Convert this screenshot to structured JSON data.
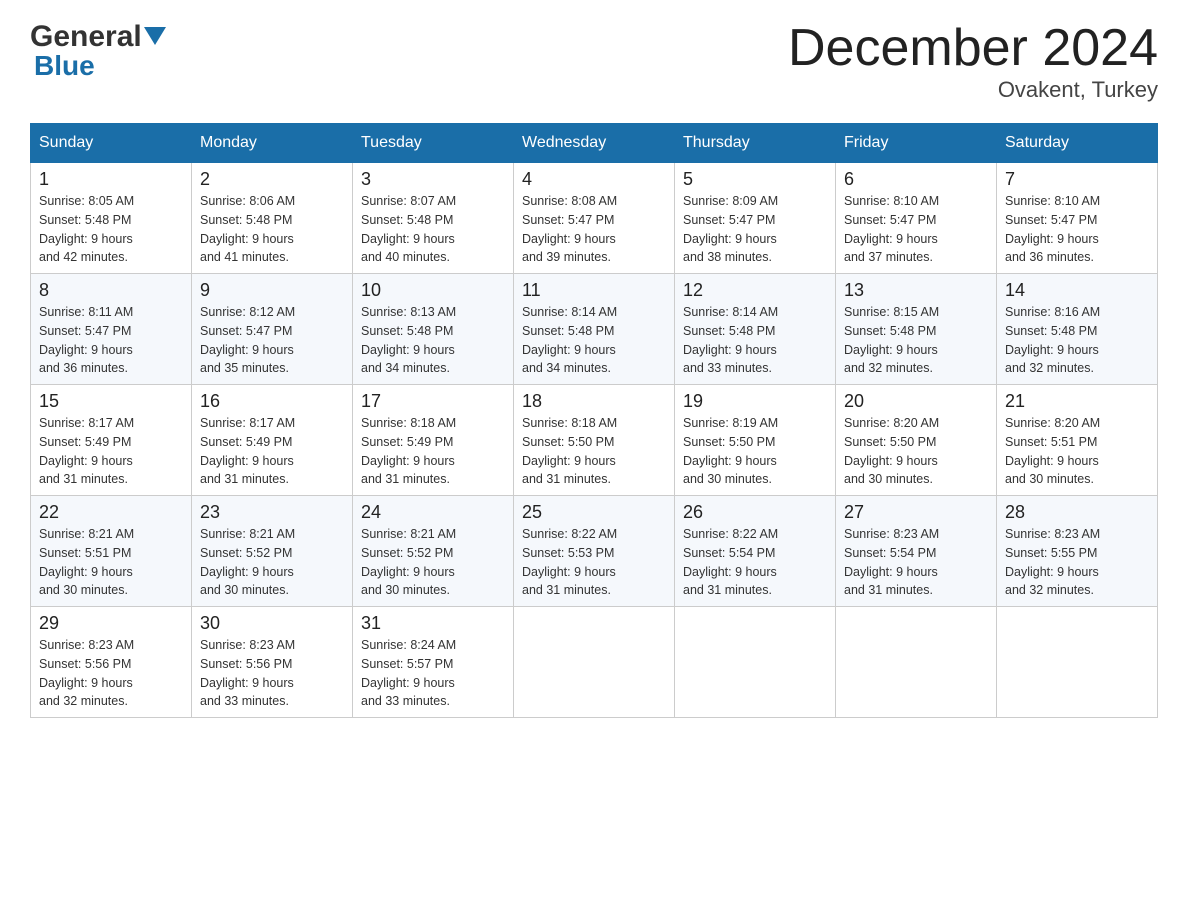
{
  "header": {
    "logo_general": "General",
    "logo_blue": "Blue",
    "title": "December 2024",
    "subtitle": "Ovakent, Turkey"
  },
  "days_of_week": [
    "Sunday",
    "Monday",
    "Tuesday",
    "Wednesday",
    "Thursday",
    "Friday",
    "Saturday"
  ],
  "weeks": [
    [
      {
        "num": "1",
        "sunrise": "8:05 AM",
        "sunset": "5:48 PM",
        "daylight": "9 hours and 42 minutes."
      },
      {
        "num": "2",
        "sunrise": "8:06 AM",
        "sunset": "5:48 PM",
        "daylight": "9 hours and 41 minutes."
      },
      {
        "num": "3",
        "sunrise": "8:07 AM",
        "sunset": "5:48 PM",
        "daylight": "9 hours and 40 minutes."
      },
      {
        "num": "4",
        "sunrise": "8:08 AM",
        "sunset": "5:47 PM",
        "daylight": "9 hours and 39 minutes."
      },
      {
        "num": "5",
        "sunrise": "8:09 AM",
        "sunset": "5:47 PM",
        "daylight": "9 hours and 38 minutes."
      },
      {
        "num": "6",
        "sunrise": "8:10 AM",
        "sunset": "5:47 PM",
        "daylight": "9 hours and 37 minutes."
      },
      {
        "num": "7",
        "sunrise": "8:10 AM",
        "sunset": "5:47 PM",
        "daylight": "9 hours and 36 minutes."
      }
    ],
    [
      {
        "num": "8",
        "sunrise": "8:11 AM",
        "sunset": "5:47 PM",
        "daylight": "9 hours and 36 minutes."
      },
      {
        "num": "9",
        "sunrise": "8:12 AM",
        "sunset": "5:47 PM",
        "daylight": "9 hours and 35 minutes."
      },
      {
        "num": "10",
        "sunrise": "8:13 AM",
        "sunset": "5:48 PM",
        "daylight": "9 hours and 34 minutes."
      },
      {
        "num": "11",
        "sunrise": "8:14 AM",
        "sunset": "5:48 PM",
        "daylight": "9 hours and 34 minutes."
      },
      {
        "num": "12",
        "sunrise": "8:14 AM",
        "sunset": "5:48 PM",
        "daylight": "9 hours and 33 minutes."
      },
      {
        "num": "13",
        "sunrise": "8:15 AM",
        "sunset": "5:48 PM",
        "daylight": "9 hours and 32 minutes."
      },
      {
        "num": "14",
        "sunrise": "8:16 AM",
        "sunset": "5:48 PM",
        "daylight": "9 hours and 32 minutes."
      }
    ],
    [
      {
        "num": "15",
        "sunrise": "8:17 AM",
        "sunset": "5:49 PM",
        "daylight": "9 hours and 31 minutes."
      },
      {
        "num": "16",
        "sunrise": "8:17 AM",
        "sunset": "5:49 PM",
        "daylight": "9 hours and 31 minutes."
      },
      {
        "num": "17",
        "sunrise": "8:18 AM",
        "sunset": "5:49 PM",
        "daylight": "9 hours and 31 minutes."
      },
      {
        "num": "18",
        "sunrise": "8:18 AM",
        "sunset": "5:50 PM",
        "daylight": "9 hours and 31 minutes."
      },
      {
        "num": "19",
        "sunrise": "8:19 AM",
        "sunset": "5:50 PM",
        "daylight": "9 hours and 30 minutes."
      },
      {
        "num": "20",
        "sunrise": "8:20 AM",
        "sunset": "5:50 PM",
        "daylight": "9 hours and 30 minutes."
      },
      {
        "num": "21",
        "sunrise": "8:20 AM",
        "sunset": "5:51 PM",
        "daylight": "9 hours and 30 minutes."
      }
    ],
    [
      {
        "num": "22",
        "sunrise": "8:21 AM",
        "sunset": "5:51 PM",
        "daylight": "9 hours and 30 minutes."
      },
      {
        "num": "23",
        "sunrise": "8:21 AM",
        "sunset": "5:52 PM",
        "daylight": "9 hours and 30 minutes."
      },
      {
        "num": "24",
        "sunrise": "8:21 AM",
        "sunset": "5:52 PM",
        "daylight": "9 hours and 30 minutes."
      },
      {
        "num": "25",
        "sunrise": "8:22 AM",
        "sunset": "5:53 PM",
        "daylight": "9 hours and 31 minutes."
      },
      {
        "num": "26",
        "sunrise": "8:22 AM",
        "sunset": "5:54 PM",
        "daylight": "9 hours and 31 minutes."
      },
      {
        "num": "27",
        "sunrise": "8:23 AM",
        "sunset": "5:54 PM",
        "daylight": "9 hours and 31 minutes."
      },
      {
        "num": "28",
        "sunrise": "8:23 AM",
        "sunset": "5:55 PM",
        "daylight": "9 hours and 32 minutes."
      }
    ],
    [
      {
        "num": "29",
        "sunrise": "8:23 AM",
        "sunset": "5:56 PM",
        "daylight": "9 hours and 32 minutes."
      },
      {
        "num": "30",
        "sunrise": "8:23 AM",
        "sunset": "5:56 PM",
        "daylight": "9 hours and 33 minutes."
      },
      {
        "num": "31",
        "sunrise": "8:24 AM",
        "sunset": "5:57 PM",
        "daylight": "9 hours and 33 minutes."
      },
      null,
      null,
      null,
      null
    ]
  ],
  "labels": {
    "sunrise_prefix": "Sunrise: ",
    "sunset_prefix": "Sunset: ",
    "daylight_prefix": "Daylight: "
  }
}
